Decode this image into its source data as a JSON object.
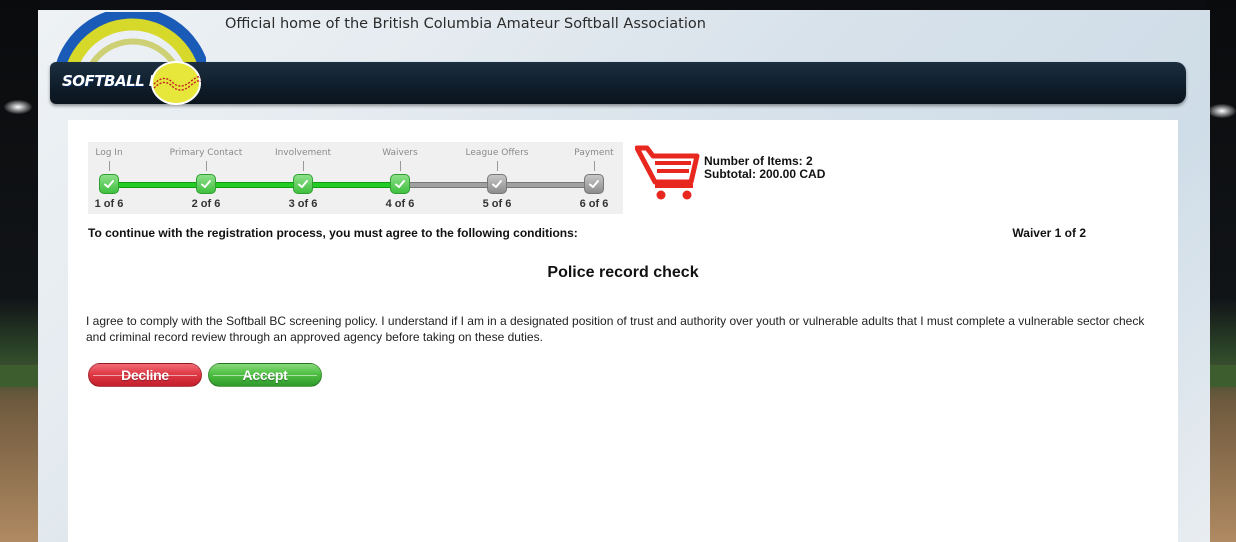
{
  "header": {
    "tagline": "Official home of the British Columbia Amateur Softball Association",
    "logo_text": "SOFTBALL B.C."
  },
  "progress": {
    "steps": [
      {
        "label": "Log In",
        "count": "1 of 6",
        "status": "complete"
      },
      {
        "label": "Primary Contact",
        "count": "2 of 6",
        "status": "complete"
      },
      {
        "label": "Involvement",
        "count": "3 of 6",
        "status": "complete"
      },
      {
        "label": "Waivers",
        "count": "4 of 6",
        "status": "complete"
      },
      {
        "label": "League Offers",
        "count": "5 of 6",
        "status": "incomplete"
      },
      {
        "label": "Payment",
        "count": "6 of 6",
        "status": "incomplete"
      }
    ]
  },
  "cart": {
    "items_text": "Number of Items: 2",
    "subtotal_text": "Subtotal: 200.00 CAD",
    "icon": "shopping-cart-icon",
    "color": "#e8271f"
  },
  "waiver": {
    "instruction": "To continue with the registration process, you must agree to the following conditions:",
    "counter": "Waiver 1 of 2",
    "title": "Police record check",
    "body": "I agree to comply with the Softball BC screening policy. I understand if I am in a designated position of trust and authority over youth or vulnerable adults that I must complete a vulnerable sector check and criminal record review through an approved agency before taking on these duties."
  },
  "actions": {
    "decline_label": "Decline",
    "accept_label": "Accept",
    "decline_color": "#d62b37",
    "accept_color": "#44b43a"
  },
  "colors": {
    "header_bar": "#122434",
    "progress_done": "#22cc22",
    "progress_todo": "#a0a0a0"
  }
}
